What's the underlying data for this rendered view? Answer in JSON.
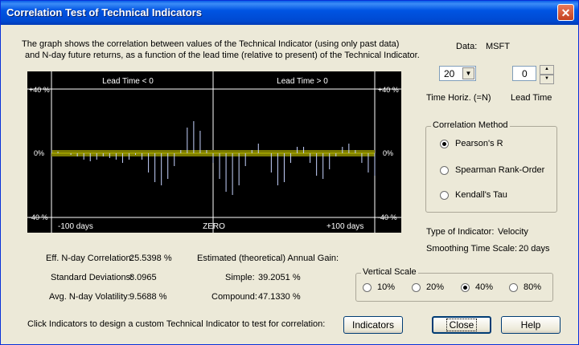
{
  "window": {
    "title": "Correlation Test of Technical Indicators",
    "close_glyph": "✕"
  },
  "description": {
    "line1": "The graph shows the correlation between values of the Technical Indicator (using only past data)",
    "line2": "and N-day future returns, as a function of the lead time (relative to present) of the Technical Indicator."
  },
  "chart": {
    "lead_neg_label": "Lead Time < 0",
    "lead_pos_label": "Lead Time > 0",
    "y_top": "+40 %",
    "y_mid": "0%",
    "y_bot": "-40 %",
    "x_left": "-100 days",
    "x_mid": "ZERO",
    "x_right": "+100 days"
  },
  "chart_data": {
    "type": "bar",
    "x_range": [
      -100,
      100
    ],
    "ylim": [
      -40,
      40
    ],
    "band": [
      -2,
      2
    ],
    "zero_line": 0,
    "colors": {
      "bars": "#c6d3ff",
      "band": "#7a7a00",
      "bg": "#000000",
      "grid": "#ffffff"
    },
    "x": [
      -100,
      -96,
      -92,
      -88,
      -84,
      -80,
      -76,
      -72,
      -68,
      -64,
      -60,
      -56,
      -52,
      -48,
      -44,
      -40,
      -36,
      -32,
      -28,
      -24,
      -20,
      -16,
      -12,
      -8,
      -4,
      0,
      4,
      8,
      12,
      16,
      20,
      24,
      28,
      32,
      36,
      40,
      44,
      48,
      52,
      56,
      60,
      64,
      68,
      72,
      76,
      80,
      84,
      88,
      92,
      96,
      100
    ],
    "values": [
      2,
      1,
      0,
      -1,
      -2,
      -4,
      -5,
      -4,
      -2,
      -3,
      -4,
      -6,
      -4,
      -1,
      -4,
      -12,
      -18,
      -20,
      -16,
      -8,
      2,
      16,
      20,
      14,
      2,
      -6,
      -16,
      -24,
      -26,
      -20,
      -8,
      2,
      6,
      0,
      -12,
      -20,
      -18,
      -6,
      4,
      4,
      -6,
      -14,
      -16,
      -10,
      -2,
      4,
      6,
      2,
      -6,
      -12,
      -14
    ]
  },
  "data_label": {
    "label": "Data:",
    "value": "MSFT"
  },
  "time_horiz": {
    "value": "20",
    "label": "Time Horiz. (=N)",
    "arrow": "▼"
  },
  "lead_time": {
    "value": "0",
    "label": "Lead Time",
    "up": "▲",
    "down": "▼"
  },
  "method": {
    "title": "Correlation Method",
    "options": [
      "Pearson's R",
      "Spearman Rank-Order",
      "Kendall's Tau"
    ],
    "selected": 0
  },
  "indicator": {
    "type_label": "Type of Indicator:",
    "type_value": "Velocity",
    "smooth_label": "Smoothing Time Scale:",
    "smooth_value": "20 days"
  },
  "stats": {
    "corr_label": "Eff. N-day Correlation:",
    "corr_value": "25.5398 %",
    "std_label": "Standard Deviations:",
    "std_value": "8.0965",
    "vol_label": "Avg. N-day Volatility:",
    "vol_value": "9.5688 %",
    "gain_label": "Estimated (theoretical) Annual Gain:",
    "simple_label": "Simple:",
    "simple_value": "39.2051 %",
    "compound_label": "Compound:",
    "compound_value": "47.1330 %"
  },
  "vscale": {
    "title": "Vertical Scale",
    "options": [
      "10%",
      "20%",
      "40%",
      "80%"
    ],
    "selected": 2
  },
  "footer": {
    "hint": "Click Indicators to design a custom Technical Indicator to test for correlation:"
  },
  "buttons": {
    "indicators": "Indicators",
    "close": "Close",
    "help": "Help"
  }
}
